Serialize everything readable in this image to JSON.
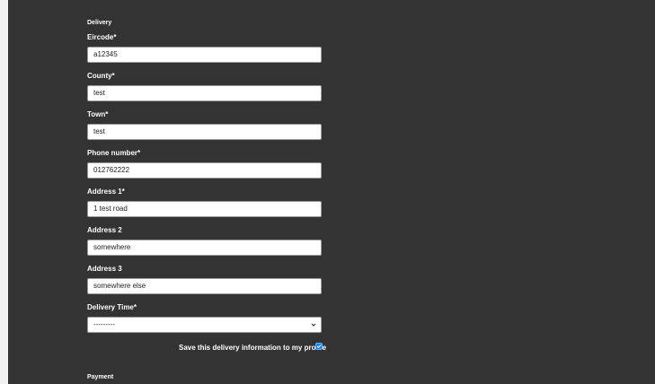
{
  "header_fragment": "",
  "delivery": {
    "section_title": "Delivery",
    "fields": [
      {
        "label": "Eircode*",
        "value": "a12345"
      },
      {
        "label": "County*",
        "value": "test"
      },
      {
        "label": "Town*",
        "value": "test"
      },
      {
        "label": "Phone number*",
        "value": "012762222"
      },
      {
        "label": "Address 1*",
        "value": "1 test road"
      },
      {
        "label": "Address 2",
        "value": "somewhere"
      },
      {
        "label": "Address 3",
        "value": "somewhere else"
      }
    ],
    "delivery_time": {
      "label": "Delivery Time*",
      "selected": "---------"
    },
    "save_info_label": "Save this delivery information to my profile",
    "save_info_checked": true
  },
  "payment": {
    "section_title": "Payment"
  }
}
